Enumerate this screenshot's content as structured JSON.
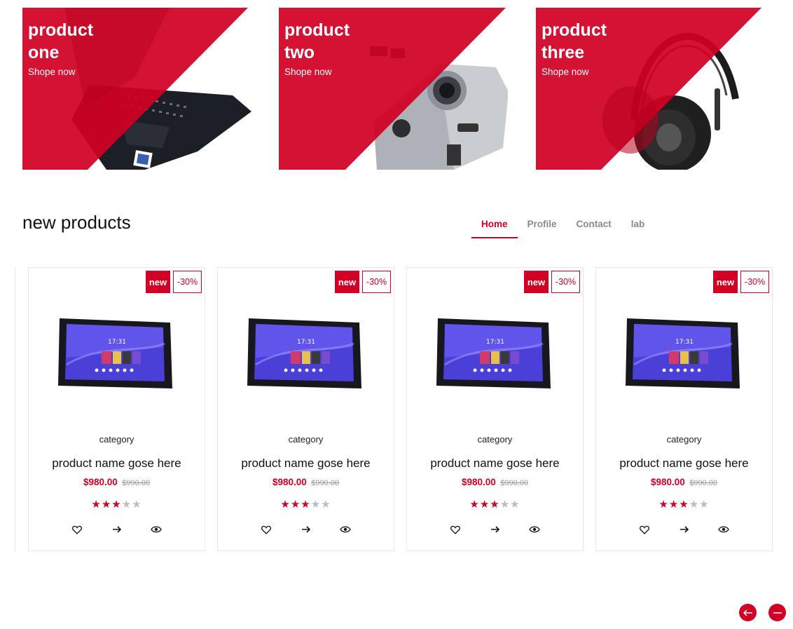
{
  "banners": [
    {
      "title": "product\none",
      "cta": "Shope now"
    },
    {
      "title": "product\ntwo",
      "cta": "Shope now"
    },
    {
      "title": "product\nthree",
      "cta": "Shope now"
    }
  ],
  "section": {
    "title": "new products",
    "tabs": [
      "Home",
      "Profile",
      "Contact",
      "lab"
    ],
    "active_tab": "Home"
  },
  "products": [
    {
      "badge_new": "new",
      "badge_sale": "-30%",
      "category": "category",
      "name": "product name gose here",
      "price": "$980.00",
      "old_price": "$990.00",
      "rating": 3,
      "rating_max": 5
    },
    {
      "badge_new": "new",
      "badge_sale": "-30%",
      "category": "category",
      "name": "product name gose here",
      "price": "$980.00",
      "old_price": "$990.00",
      "rating": 3,
      "rating_max": 5
    },
    {
      "badge_new": "new",
      "badge_sale": "-30%",
      "category": "category",
      "name": "product name gose here",
      "price": "$980.00",
      "old_price": "$990.00",
      "rating": 3,
      "rating_max": 5
    },
    {
      "badge_new": "new",
      "badge_sale": "-30%",
      "category": "category",
      "name": "product name gose here",
      "price": "$980.00",
      "old_price": "$990.00",
      "rating": 3,
      "rating_max": 5
    }
  ],
  "tablet_screen": {
    "time": "17:31"
  },
  "icons": {
    "wishlist": "heart-icon",
    "compare": "arrow-right-icon",
    "quick_view": "eye-icon",
    "prev": "arrow-left-icon",
    "next": "arrow-right-icon"
  },
  "colors": {
    "accent": "#d10024",
    "star_off": "#bcbcbc",
    "border": "#e4e7ed"
  }
}
